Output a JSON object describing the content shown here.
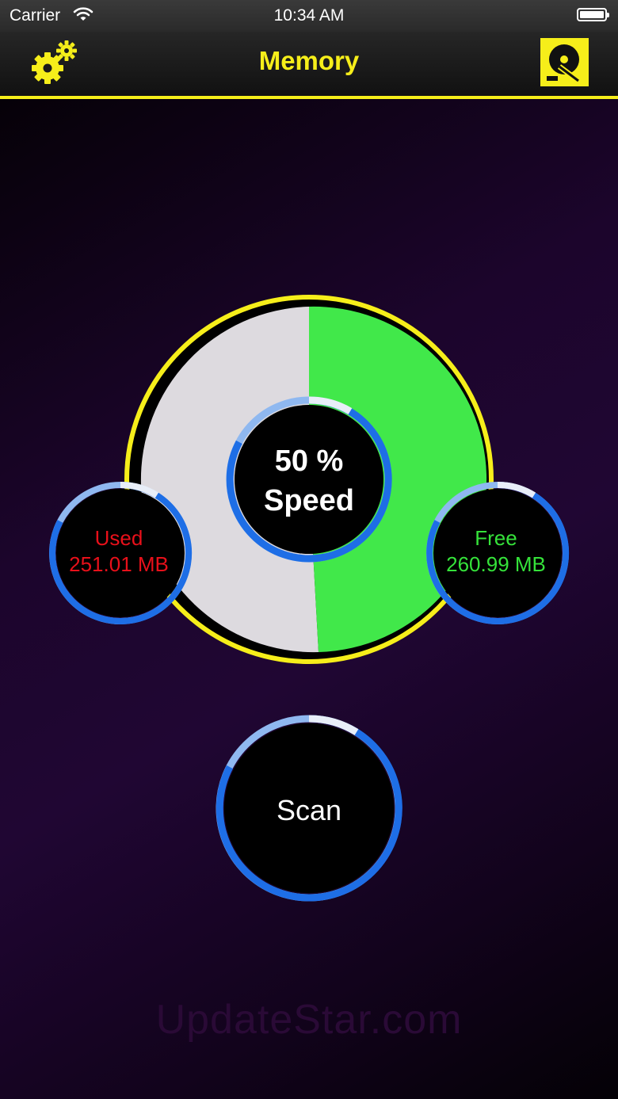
{
  "status_bar": {
    "carrier": "Carrier",
    "time": "10:34 AM"
  },
  "nav": {
    "title": "Memory",
    "left_icon": "settings-gears-icon",
    "right_icon": "disk-cleaner-icon"
  },
  "gauge": {
    "speed_percent": "50 %",
    "speed_label": "Speed",
    "used_label": "Used",
    "used_value": "251.01 MB",
    "free_label": "Free",
    "free_value": "260.99 MB",
    "used_fraction": 0.49,
    "colors": {
      "used": "#dddadf",
      "free": "#41e84a",
      "ring": "#f6ee1a",
      "accent_blue": "#1e6ee6"
    }
  },
  "scan": {
    "label": "Scan"
  },
  "watermark": "UpdateStar.com",
  "colors": {
    "title_yellow": "#f6ee1a",
    "used_red": "#e8101a",
    "free_green": "#35e23a"
  }
}
